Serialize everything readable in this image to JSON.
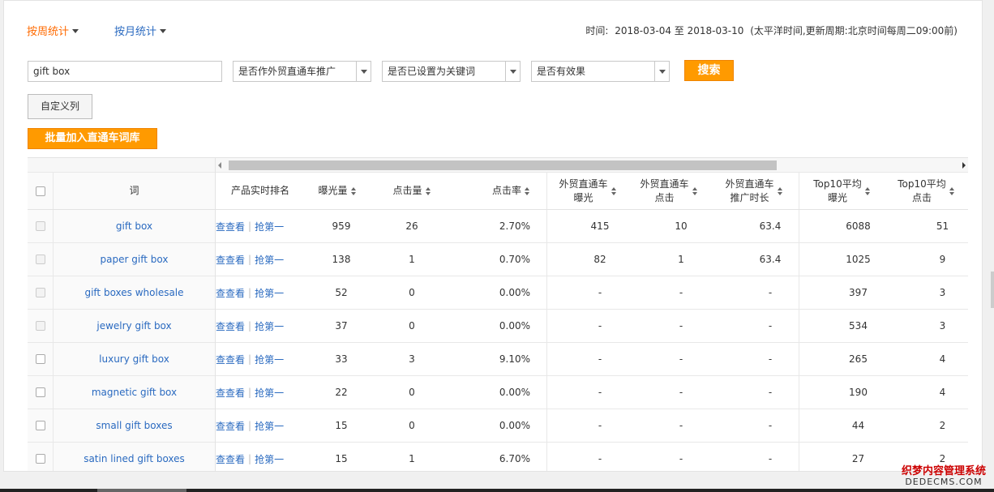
{
  "tabs": {
    "weekly": "按周统计",
    "monthly": "按月统计"
  },
  "time_info": {
    "label": "时间:",
    "range": "2018-03-04 至 2018-03-10",
    "note": "(太平洋时间,更新周期:北京时间每周二09:00前)"
  },
  "filters": {
    "search_value": "gift box",
    "select_promo": "是否作外贸直通车推广",
    "select_keyword": "是否已设置为关键词",
    "select_effective": "是否有效果",
    "search_button": "搜索"
  },
  "buttons": {
    "custom_columns": "自定义列",
    "bulk_add": "批量加入直通车词库"
  },
  "table": {
    "headers": {
      "word": "词",
      "rank": "产品实时排名",
      "impressions": "曝光量",
      "clicks": "点击量",
      "ctr": "点击率",
      "p4p_imp_1": "外贸直通车",
      "p4p_imp_2": "曝光",
      "p4p_clk_1": "外贸直通车",
      "p4p_clk_2": "点击",
      "p4p_dur_1": "外贸直通车",
      "p4p_dur_2": "推广时长",
      "top10_imp_1": "Top10平均",
      "top10_imp_2": "曝光",
      "top10_clk_1": "Top10平均",
      "top10_clk_2": "点击"
    },
    "action_view": "查查看",
    "action_grab": "抢第一",
    "rows": [
      {
        "word": "gift box",
        "imp": "959",
        "clk": "26",
        "ctr": "2.70%",
        "ximp": "415",
        "xclk": "10",
        "xdur": "63.4",
        "t10i": "6088",
        "t10c": "51"
      },
      {
        "word": "paper gift box",
        "imp": "138",
        "clk": "1",
        "ctr": "0.70%",
        "ximp": "82",
        "xclk": "1",
        "xdur": "63.4",
        "t10i": "1025",
        "t10c": "9"
      },
      {
        "word": "gift boxes wholesale",
        "imp": "52",
        "clk": "0",
        "ctr": "0.00%",
        "ximp": "-",
        "xclk": "-",
        "xdur": "-",
        "t10i": "397",
        "t10c": "3"
      },
      {
        "word": "jewelry gift box",
        "imp": "37",
        "clk": "0",
        "ctr": "0.00%",
        "ximp": "-",
        "xclk": "-",
        "xdur": "-",
        "t10i": "534",
        "t10c": "3"
      },
      {
        "word": "luxury gift box",
        "imp": "33",
        "clk": "3",
        "ctr": "9.10%",
        "ximp": "-",
        "xclk": "-",
        "xdur": "-",
        "t10i": "265",
        "t10c": "4"
      },
      {
        "word": "magnetic gift box",
        "imp": "22",
        "clk": "0",
        "ctr": "0.00%",
        "ximp": "-",
        "xclk": "-",
        "xdur": "-",
        "t10i": "190",
        "t10c": "4"
      },
      {
        "word": "small gift boxes",
        "imp": "15",
        "clk": "0",
        "ctr": "0.00%",
        "ximp": "-",
        "xclk": "-",
        "xdur": "-",
        "t10i": "44",
        "t10c": "2"
      },
      {
        "word": "satin lined gift boxes",
        "imp": "15",
        "clk": "1",
        "ctr": "6.70%",
        "ximp": "-",
        "xclk": "-",
        "xdur": "-",
        "t10i": "27",
        "t10c": "2"
      }
    ]
  },
  "watermark": {
    "line1": "织梦内容管理系统",
    "line2": "DEDECMS.COM"
  },
  "colors": {
    "accent": "#ff6a00",
    "link": "#2a6ac0",
    "button": "#ff9a00"
  }
}
